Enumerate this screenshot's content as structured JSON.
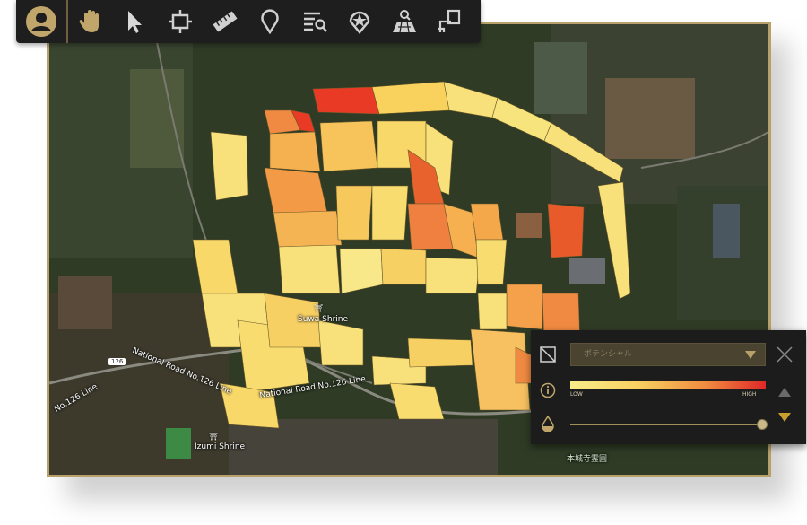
{
  "toolbar": {
    "tools": [
      {
        "name": "user-avatar-icon"
      },
      {
        "name": "hand-pan-icon"
      },
      {
        "name": "pointer-select-icon"
      },
      {
        "name": "crosshair-frame-icon"
      },
      {
        "name": "ruler-icon"
      },
      {
        "name": "map-pin-icon"
      },
      {
        "name": "list-search-icon"
      },
      {
        "name": "star-pin-icon"
      },
      {
        "name": "field-search-icon"
      },
      {
        "name": "export-icon"
      }
    ],
    "accent_color": "#b8a06a"
  },
  "map": {
    "labels": {
      "suwa_shrine": "Suwa Shrine",
      "road_126_upper": "National Road No.126 Line",
      "road_126_lower": "National Road No.126 Line",
      "road_126_left": "No.126 Line",
      "route_shield": "126",
      "izumi_shrine": "Izumi Shrine",
      "bottom_right_label": "本城寺霊園"
    }
  },
  "layer_panel": {
    "layer_select_value": "ポテンシャル",
    "legend_low": "LOW",
    "legend_high": "HIGH",
    "opacity_value": 1.0,
    "legend_colors": [
      "#f7ec8a",
      "#f8d060",
      "#f08a40",
      "#e02828"
    ]
  }
}
